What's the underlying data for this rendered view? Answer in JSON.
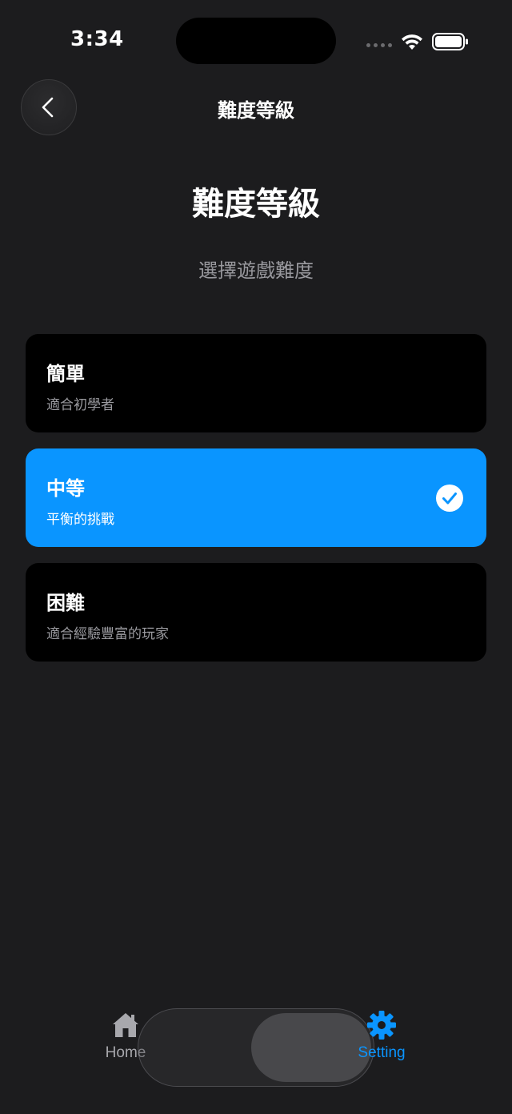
{
  "status_bar": {
    "time": "3:34"
  },
  "nav": {
    "title": "難度等級",
    "back_icon": "chevron-left-icon"
  },
  "header": {
    "title": "難度等級",
    "subtitle": "選擇遊戲難度"
  },
  "options": [
    {
      "title": "簡單",
      "description": "適合初學者",
      "selected": false
    },
    {
      "title": "中等",
      "description": "平衡的挑戰",
      "selected": true
    },
    {
      "title": "困難",
      "description": "適合經驗豐富的玩家",
      "selected": false
    }
  ],
  "tab_bar": {
    "items": [
      {
        "label": "Home",
        "icon": "house-icon",
        "active": false
      },
      {
        "label": "Setting",
        "icon": "gear-icon",
        "active": true
      }
    ]
  },
  "colors": {
    "background": "#1c1c1e",
    "accent": "#0a95ff",
    "card": "#000000",
    "secondary_text": "#98989d"
  }
}
